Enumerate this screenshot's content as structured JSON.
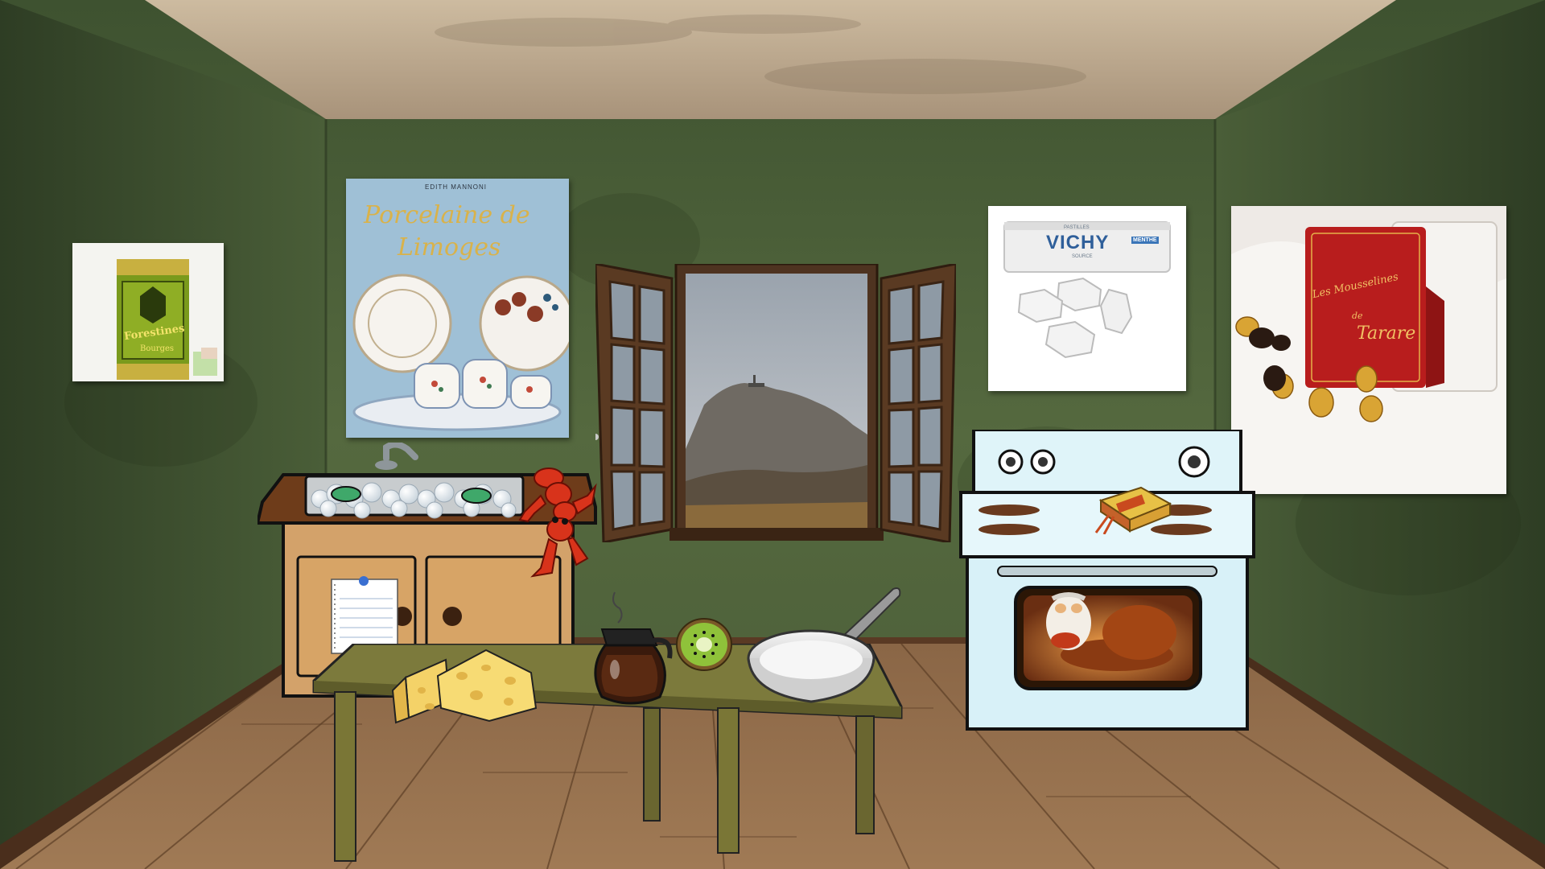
{
  "scene": {
    "colors": {
      "wall": "#4a5e38",
      "wall_dark": "#34442a",
      "ceiling": "#b9a58a",
      "floor": "#9a7350",
      "floor_dark": "#6b4a30"
    }
  },
  "posters": {
    "forestines": {
      "label_top": "Forestines",
      "label_bottom": "Bourges"
    },
    "limoges": {
      "author": "EDITH MANNONI",
      "title_line1": "Porcelaine de",
      "title_line2": "Limoges"
    },
    "vichy": {
      "brand": "VICHY",
      "pastilles": "PASTILLES",
      "menthe": "MENTHE",
      "source": "SOURCE"
    },
    "tarare": {
      "line1": "Les Mousselines",
      "line2": "de",
      "line3": "Tarare"
    }
  },
  "window": {
    "view": "puy-de-dome-mountain"
  },
  "items": {
    "sink": "sink-with-dishes",
    "crayfish": "crayfish-icon",
    "note": "pinned-note-icon",
    "cheese": "cheese-icon",
    "coffee": "coffee-pot-icon",
    "kiwi": "kiwi-icon",
    "pan": "frying-pan-icon",
    "matches": "matchbox-icon",
    "oven": "oven-with-character"
  }
}
